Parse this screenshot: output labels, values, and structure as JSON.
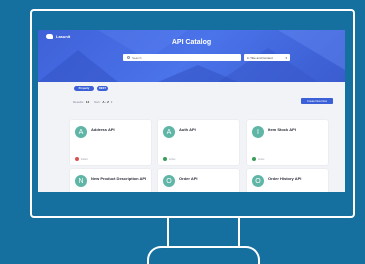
{
  "app": {
    "logo_text": "Lasunit",
    "title": "API Catalog"
  },
  "search": {
    "placeholder": "Search",
    "scope_label": "in Title and Content"
  },
  "filters": [
    "Property",
    "REST"
  ],
  "toolbar": {
    "results_label": "Results:",
    "results_count": "14",
    "sort_label": "Sort:",
    "sort_value": "A - Z",
    "create_button": "Create New Flow"
  },
  "cards": [
    {
      "initial": "A",
      "name": "Address API",
      "status": "Failed",
      "status_color": "#d9534f"
    },
    {
      "initial": "A",
      "name": "Auth API",
      "status": "Active",
      "status_color": "#3a9e58"
    },
    {
      "initial": "I",
      "name": "Item Stock API",
      "status": "Active",
      "status_color": "#3a9e58"
    },
    {
      "initial": "N",
      "name": "New Product Description API",
      "status": "",
      "status_color": ""
    },
    {
      "initial": "O",
      "name": "Order API",
      "status": "",
      "status_color": ""
    },
    {
      "initial": "O",
      "name": "Order History API",
      "status": "",
      "status_color": ""
    }
  ],
  "colors": {
    "background": "#1570a0",
    "hero": "#4b73ea",
    "accent": "#3a5fd6",
    "avatar": "#5fb5a6"
  }
}
